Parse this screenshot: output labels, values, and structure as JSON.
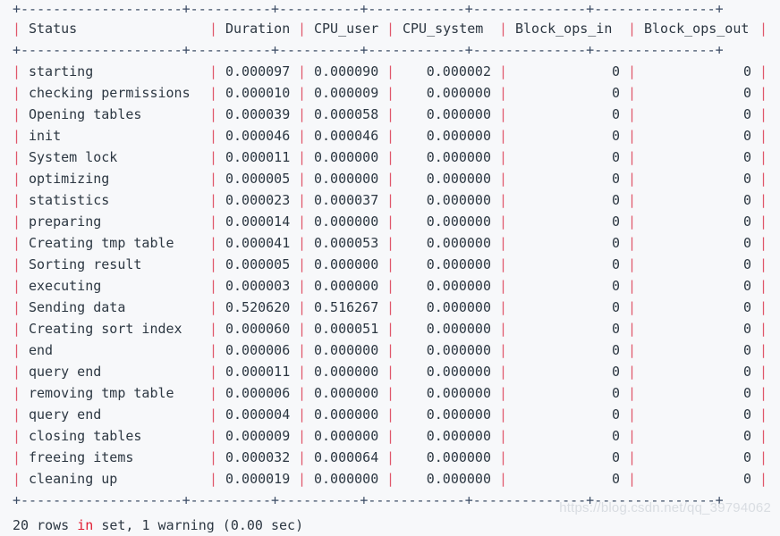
{
  "terminal": {
    "background_color": "#f7f8fa",
    "text_color": "#2c3742",
    "border_color": "#e0576b",
    "rule_color": "#3a4a63",
    "keyword_color": "#e11d32"
  },
  "table": {
    "top_rule": "+--------------------+----------+----------+------------+--------------+---------------+",
    "header_rule": "+--------------------+----------+----------+------------+--------------+---------------+",
    "bottom_rule": "+--------------------+----------+----------+------------+--------------+---------------+",
    "columns": [
      {
        "key": "status",
        "label": "Status",
        "align": "left"
      },
      {
        "key": "duration",
        "label": "Duration",
        "align": "right"
      },
      {
        "key": "cpu_user",
        "label": "CPU_user",
        "align": "right"
      },
      {
        "key": "cpu_system",
        "label": "CPU_system",
        "align": "right"
      },
      {
        "key": "block_in",
        "label": "Block_ops_in",
        "align": "right"
      },
      {
        "key": "block_out",
        "label": "Block_ops_out",
        "align": "right"
      }
    ],
    "rows": [
      {
        "status": "starting",
        "duration": "0.000097",
        "cpu_user": "0.000090",
        "cpu_system": "0.000002",
        "block_in": "0",
        "block_out": "0"
      },
      {
        "status": "checking permissions",
        "duration": "0.000010",
        "cpu_user": "0.000009",
        "cpu_system": "0.000000",
        "block_in": "0",
        "block_out": "0"
      },
      {
        "status": "Opening tables",
        "duration": "0.000039",
        "cpu_user": "0.000058",
        "cpu_system": "0.000000",
        "block_in": "0",
        "block_out": "0"
      },
      {
        "status": "init",
        "duration": "0.000046",
        "cpu_user": "0.000046",
        "cpu_system": "0.000000",
        "block_in": "0",
        "block_out": "0"
      },
      {
        "status": "System lock",
        "duration": "0.000011",
        "cpu_user": "0.000000",
        "cpu_system": "0.000000",
        "block_in": "0",
        "block_out": "0"
      },
      {
        "status": "optimizing",
        "duration": "0.000005",
        "cpu_user": "0.000000",
        "cpu_system": "0.000000",
        "block_in": "0",
        "block_out": "0"
      },
      {
        "status": "statistics",
        "duration": "0.000023",
        "cpu_user": "0.000037",
        "cpu_system": "0.000000",
        "block_in": "0",
        "block_out": "0"
      },
      {
        "status": "preparing",
        "duration": "0.000014",
        "cpu_user": "0.000000",
        "cpu_system": "0.000000",
        "block_in": "0",
        "block_out": "0"
      },
      {
        "status": "Creating tmp table",
        "duration": "0.000041",
        "cpu_user": "0.000053",
        "cpu_system": "0.000000",
        "block_in": "0",
        "block_out": "0"
      },
      {
        "status": "Sorting result",
        "duration": "0.000005",
        "cpu_user": "0.000000",
        "cpu_system": "0.000000",
        "block_in": "0",
        "block_out": "0"
      },
      {
        "status": "executing",
        "duration": "0.000003",
        "cpu_user": "0.000000",
        "cpu_system": "0.000000",
        "block_in": "0",
        "block_out": "0"
      },
      {
        "status": "Sending data",
        "duration": "0.520620",
        "cpu_user": "0.516267",
        "cpu_system": "0.000000",
        "block_in": "0",
        "block_out": "0"
      },
      {
        "status": "Creating sort index",
        "duration": "0.000060",
        "cpu_user": "0.000051",
        "cpu_system": "0.000000",
        "block_in": "0",
        "block_out": "0"
      },
      {
        "status": "end",
        "duration": "0.000006",
        "cpu_user": "0.000000",
        "cpu_system": "0.000000",
        "block_in": "0",
        "block_out": "0"
      },
      {
        "status": "query end",
        "duration": "0.000011",
        "cpu_user": "0.000000",
        "cpu_system": "0.000000",
        "block_in": "0",
        "block_out": "0"
      },
      {
        "status": "removing tmp table",
        "duration": "0.000006",
        "cpu_user": "0.000000",
        "cpu_system": "0.000000",
        "block_in": "0",
        "block_out": "0"
      },
      {
        "status": "query end",
        "duration": "0.000004",
        "cpu_user": "0.000000",
        "cpu_system": "0.000000",
        "block_in": "0",
        "block_out": "0"
      },
      {
        "status": "closing tables",
        "duration": "0.000009",
        "cpu_user": "0.000000",
        "cpu_system": "0.000000",
        "block_in": "0",
        "block_out": "0"
      },
      {
        "status": "freeing items",
        "duration": "0.000032",
        "cpu_user": "0.000064",
        "cpu_system": "0.000000",
        "block_in": "0",
        "block_out": "0"
      },
      {
        "status": "cleaning up",
        "duration": "0.000019",
        "cpu_user": "0.000000",
        "cpu_system": "0.000000",
        "block_in": "0",
        "block_out": "0"
      }
    ]
  },
  "result_summary": {
    "prefix": "20 rows ",
    "keyword": "in",
    "suffix": " set, 1 warning (0.00 sec)",
    "full_text": "20 rows in set, 1 warning (0.00 sec)",
    "row_count": "20",
    "warning_count": "1",
    "elapsed": "0.00 sec"
  },
  "watermark": {
    "text": "https://blog.csdn.net/qq_39794062"
  }
}
